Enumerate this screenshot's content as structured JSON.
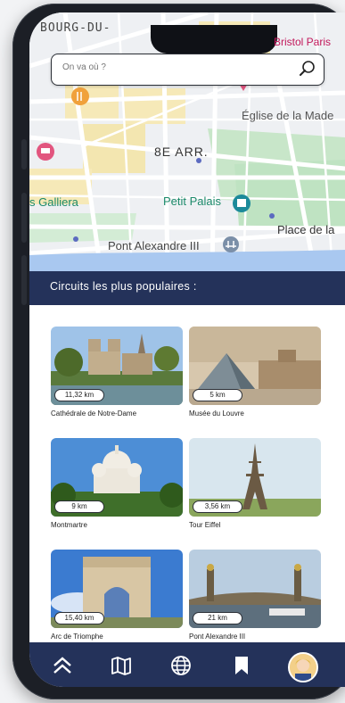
{
  "map": {
    "top_left_label": "BOURG-DU-",
    "top_right_label": "Bristol Paris",
    "labels": {
      "arrondissement": "8E ARR.",
      "eglise": "Église de la Made",
      "galliera": "s Galliera",
      "petit_palais": "Petit Palais",
      "place": "Place de la",
      "pont": "Pont Alexandre III"
    }
  },
  "search": {
    "value": "",
    "placeholder": "On va où ?",
    "icon": "search-icon"
  },
  "section": {
    "title": "Circuits les plus populaires :"
  },
  "circuits": [
    {
      "title": "Cathédrale de Notre-Dame",
      "distance": "11,32 km"
    },
    {
      "title": "Musée du Louvre",
      "distance": "5 km"
    },
    {
      "title": "Montmartre",
      "distance": "9 km"
    },
    {
      "title": "Tour Eiffel",
      "distance": "3,56 km"
    },
    {
      "title": "Arc de Triomphe",
      "distance": "15,40 km"
    },
    {
      "title": "Pont Alexandre III",
      "distance": "21 km"
    }
  ],
  "nav": {
    "items": [
      {
        "icon": "chevrons-up-icon"
      },
      {
        "icon": "map-icon"
      },
      {
        "icon": "globe-icon"
      },
      {
        "icon": "bookmark-icon"
      },
      {
        "icon": "avatar"
      }
    ]
  },
  "colors": {
    "primary": "#24325a",
    "map_green": "#c8e6c9",
    "map_water": "#a9c8f0"
  }
}
